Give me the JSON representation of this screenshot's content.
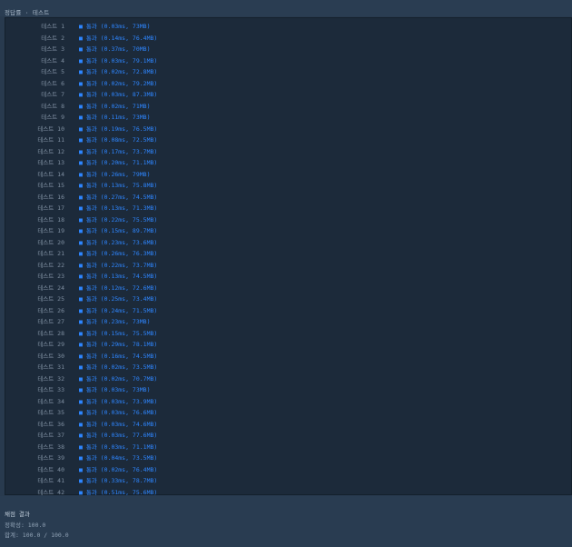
{
  "header": {
    "title": "정답률 · 테스트"
  },
  "tests": [
    {
      "label": "테스트 1",
      "result": "■ 통과 (0.03ms, 73MB)"
    },
    {
      "label": "테스트 2",
      "result": "■ 통과 (0.14ms, 76.4MB)"
    },
    {
      "label": "테스트 3",
      "result": "■ 통과 (0.37ms, 70MB)"
    },
    {
      "label": "테스트 4",
      "result": "■ 통과 (0.03ms, 79.1MB)"
    },
    {
      "label": "테스트 5",
      "result": "■ 통과 (0.02ms, 72.8MB)"
    },
    {
      "label": "테스트 6",
      "result": "■ 통과 (0.02ms, 79.2MB)"
    },
    {
      "label": "테스트 7",
      "result": "■ 통과 (0.03ms, 87.3MB)"
    },
    {
      "label": "테스트 8",
      "result": "■ 통과 (0.02ms, 71MB)"
    },
    {
      "label": "테스트 9",
      "result": "■ 통과 (0.11ms, 73MB)"
    },
    {
      "label": "테스트 10",
      "result": "■ 통과 (0.19ms, 76.5MB)"
    },
    {
      "label": "테스트 11",
      "result": "■ 통과 (0.08ms, 72.5MB)"
    },
    {
      "label": "테스트 12",
      "result": "■ 통과 (0.17ms, 73.7MB)"
    },
    {
      "label": "테스트 13",
      "result": "■ 통과 (0.20ms, 71.1MB)"
    },
    {
      "label": "테스트 14",
      "result": "■ 통과 (0.26ms, 79MB)"
    },
    {
      "label": "테스트 15",
      "result": "■ 통과 (0.13ms, 75.8MB)"
    },
    {
      "label": "테스트 16",
      "result": "■ 통과 (0.27ms, 74.5MB)"
    },
    {
      "label": "테스트 17",
      "result": "■ 통과 (0.13ms, 71.3MB)"
    },
    {
      "label": "테스트 18",
      "result": "■ 통과 (0.22ms, 75.5MB)"
    },
    {
      "label": "테스트 19",
      "result": "■ 통과 (0.15ms, 89.7MB)"
    },
    {
      "label": "테스트 20",
      "result": "■ 통과 (0.23ms, 73.6MB)"
    },
    {
      "label": "테스트 21",
      "result": "■ 통과 (0.26ms, 76.3MB)"
    },
    {
      "label": "테스트 22",
      "result": "■ 통과 (0.22ms, 73.7MB)"
    },
    {
      "label": "테스트 23",
      "result": "■ 통과 (0.13ms, 74.5MB)"
    },
    {
      "label": "테스트 24",
      "result": "■ 통과 (0.12ms, 72.6MB)"
    },
    {
      "label": "테스트 25",
      "result": "■ 통과 (0.25ms, 73.4MB)"
    },
    {
      "label": "테스트 26",
      "result": "■ 통과 (0.24ms, 71.5MB)"
    },
    {
      "label": "테스트 27",
      "result": "■ 통과 (0.23ms, 73MB)"
    },
    {
      "label": "테스트 28",
      "result": "■ 통과 (0.15ms, 75.5MB)"
    },
    {
      "label": "테스트 29",
      "result": "■ 통과 (0.29ms, 78.1MB)"
    },
    {
      "label": "테스트 30",
      "result": "■ 통과 (0.16ms, 74.5MB)"
    },
    {
      "label": "테스트 31",
      "result": "■ 통과 (0.02ms, 73.5MB)"
    },
    {
      "label": "테스트 32",
      "result": "■ 통과 (0.02ms, 70.7MB)"
    },
    {
      "label": "테스트 33",
      "result": "■ 통과 (0.03ms, 73MB)"
    },
    {
      "label": "테스트 34",
      "result": "■ 통과 (0.03ms, 73.9MB)"
    },
    {
      "label": "테스트 35",
      "result": "■ 통과 (0.03ms, 76.6MB)"
    },
    {
      "label": "테스트 36",
      "result": "■ 통과 (0.03ms, 74.6MB)"
    },
    {
      "label": "테스트 37",
      "result": "■ 통과 (0.03ms, 77.6MB)"
    },
    {
      "label": "테스트 38",
      "result": "■ 통과 (0.03ms, 71.1MB)"
    },
    {
      "label": "테스트 39",
      "result": "■ 통과 (0.04ms, 73.5MB)"
    },
    {
      "label": "테스트 40",
      "result": "■ 통과 (0.02ms, 76.4MB)"
    },
    {
      "label": "테스트 41",
      "result": "■ 통과 (0.33ms, 78.7MB)"
    },
    {
      "label": "테스트 42",
      "result": "■ 통과 (0.51ms, 75.6MB)"
    }
  ],
  "footer": {
    "title": "채점 결과",
    "accuracy": "정확성: 100.0",
    "total": "합계: 100.0 / 100.0"
  },
  "colors": {
    "background": "#283a4e",
    "panel": "#1c2a3a",
    "pass": "#2e86ff",
    "label": "#7f8fa1"
  }
}
